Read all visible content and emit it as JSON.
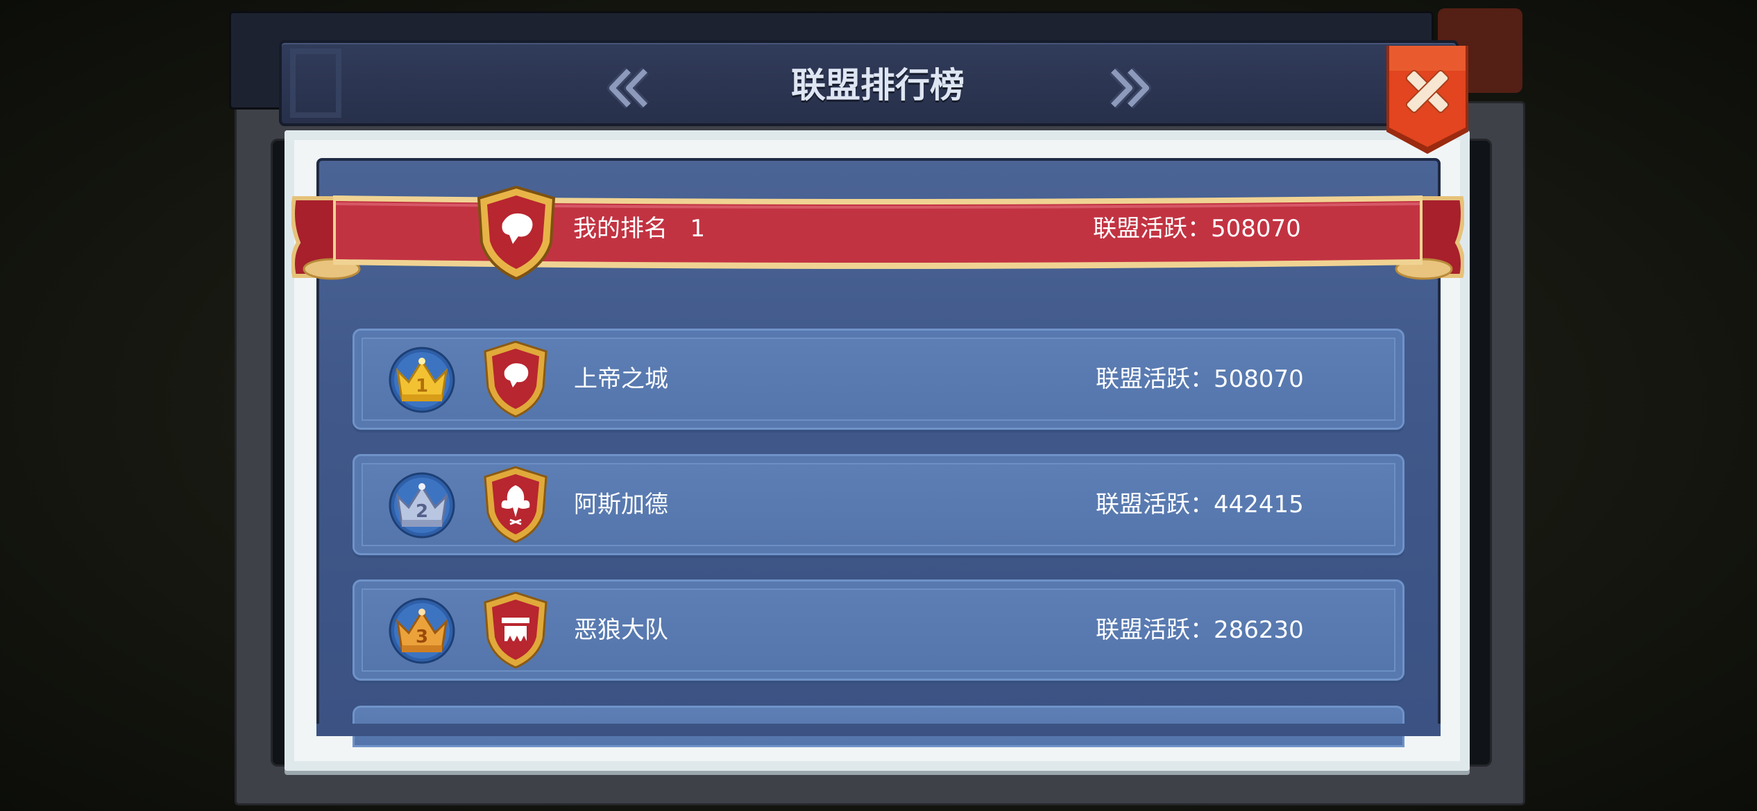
{
  "window": {
    "title": "联盟排行榜"
  },
  "my_rank": {
    "label": "我的排名",
    "rank": "1",
    "activity_label": "联盟活跃：",
    "activity_value": "508070"
  },
  "rows": [
    {
      "rank": "1",
      "name": "上帝之城",
      "activity_label": "联盟活跃：",
      "activity_value": "508070",
      "crown_color": "#f2c233",
      "emblem": "lion-emblem"
    },
    {
      "rank": "2",
      "name": "阿斯加德",
      "activity_label": "联盟活跃：",
      "activity_value": "442415",
      "crown_color": "#b9c6e2",
      "emblem": "phoenix-emblem"
    },
    {
      "rank": "3",
      "name": "恶狼大队",
      "activity_label": "联盟活跃：",
      "activity_value": "286230",
      "crown_color": "#eba23b",
      "emblem": "fortress-emblem"
    }
  ],
  "colors": {
    "ribbon_red": "#c23342",
    "close_orange": "#e2451f",
    "panel_blue": "#4b6496",
    "header_navy": "#2b3451"
  }
}
